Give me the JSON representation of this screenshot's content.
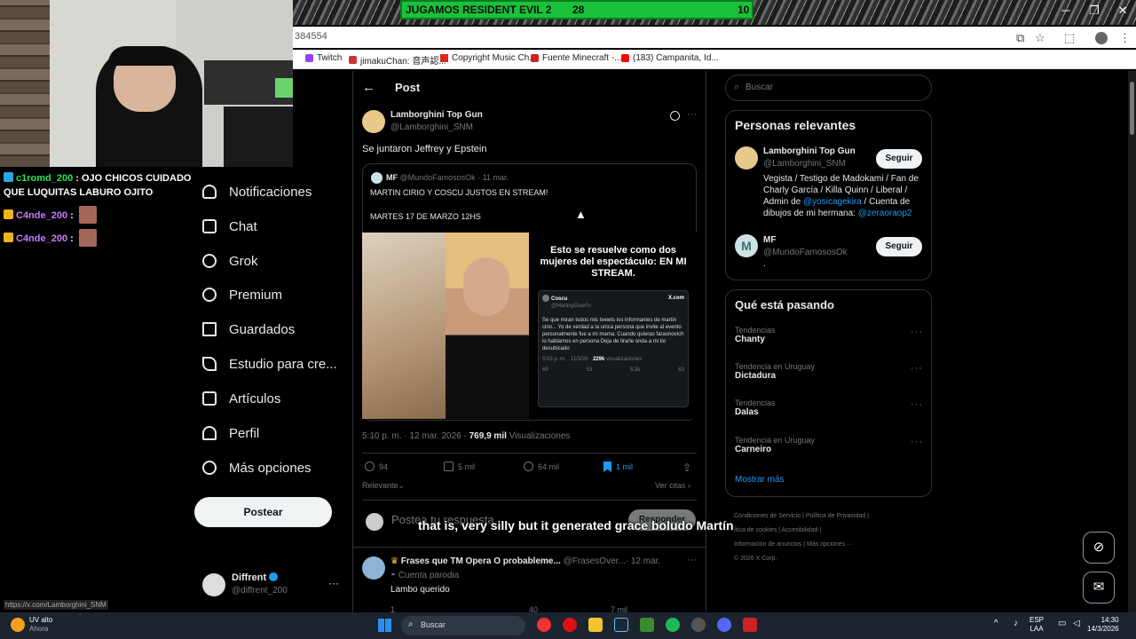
{
  "scoreboard": {
    "title": "JUGAMOS RESIDENT EVIL 2",
    "score_a": "28",
    "score_b": "10"
  },
  "browser": {
    "url": "384554",
    "bookmarks": [
      "Twitch",
      "jimakuChan: 音声認...",
      "Copyright Music Ch...",
      "Fuente Minecraft -...",
      "(183) Campanita, Id..."
    ],
    "controls": [
      "─",
      "❐",
      "✕"
    ]
  },
  "chat": [
    {
      "user": "c1romd_200",
      "message": " : OJO CHICOS CUIDADO QUE LUQUITAS LABURO OJITO"
    },
    {
      "user": "C4nde_200",
      "message": " :"
    },
    {
      "user": "C4nde_200",
      "message": " :"
    }
  ],
  "sidebar": {
    "items": [
      {
        "label": "Notificaciones",
        "icon": "bell-icon"
      },
      {
        "label": "Chat",
        "icon": "mail-icon"
      },
      {
        "label": "Grok",
        "icon": "grok-icon"
      },
      {
        "label": "Premium",
        "icon": "verified-icon"
      },
      {
        "label": "Guardados",
        "icon": "bookmark-icon"
      },
      {
        "label": "Estudio para cre...",
        "icon": "rocket-icon"
      },
      {
        "label": "Artículos",
        "icon": "article-icon"
      },
      {
        "label": "Perfil",
        "icon": "person-icon"
      },
      {
        "label": "Más opciones",
        "icon": "more-icon"
      }
    ],
    "post_button": "Postear",
    "account": {
      "name": "Diffrent",
      "handle": "@diffrent_200",
      "more": "···"
    }
  },
  "post": {
    "header_title": "Post",
    "author": "Lamborghini Top Gun",
    "handle": "@Lamborghini_SNM",
    "text": "Se juntaron Jeffrey y Epstein",
    "quote": {
      "author": "MF",
      "handle": "@MundoFamososOk",
      "date": "· 11 mar.",
      "line1": "MARTIN CIRIO Y COSCU JUSTOS EN STREAM!",
      "line2": "MARTES 17 DE MARZO 12HS",
      "image_caption": "Esto se resuelve como dos mujeres del espectáculo: EN MI STREAM.",
      "embedded_tweet": {
        "name": "Coscu",
        "handle": "@MartinpDiseño",
        "brand": "X.com",
        "body": "Se que miran todos mis tweets los informantes de martin cirio... Yo de verdad a la unica persona que invite al evento personalmente fue a mi mama. Cuando quieras faraonovich lo hablamos en persona Deja de tirarle onda a mi tio desubicado",
        "meta": "5:03 p. m. · 11/3/26 ·",
        "views": "229k",
        "views_label": " visualizaciones",
        "stats": [
          "69",
          "53",
          "5.3k",
          "83"
        ]
      }
    },
    "timestamp": "5:10 p. m. · 12 mar. 2026 · ",
    "views": "769,9 mil",
    "views_label": " Visualizaciones",
    "replies": "94",
    "reposts": "5 mil",
    "likes": "64 mil",
    "bookmarks": "1 mil",
    "sort": "Relevante",
    "see_quotes": "Ver citas",
    "reply_placeholder": "Postea tu respuesta",
    "reply_button": "Responder",
    "next": {
      "author": "Frases que TM Opera O probableme...",
      "handle": "@FrasesOver...",
      "date": "· 12 mar.",
      "label": "Cuenta parodia",
      "text": "Lambo querido",
      "stats": [
        "1",
        "",
        "40",
        "7 mil"
      ]
    }
  },
  "right": {
    "search_placeholder": "Buscar",
    "relevant_title": "Personas relevantes",
    "people": [
      {
        "name": "Lamborghini Top Gun",
        "handle": "@Lamborghini_SNM",
        "button": "Seguir",
        "bio_a": "Vegista / Testigo de Madokami / Fan de Charly García / Killa Quinn / Liberal / Admin de ",
        "bio_link1": "@yosicagekira",
        "bio_b": " / Cuenta de dibujos de mi hermana: ",
        "bio_link2": "@zeraoraop2"
      },
      {
        "name": "MF",
        "handle": "@MundoFamososOk",
        "button": "Seguir",
        "bio_a": "."
      }
    ],
    "trends_title": "Qué está pasando",
    "trends": [
      {
        "category": "Tendencias",
        "name": "Chanty"
      },
      {
        "category": "Tendencia en Uruguay",
        "name": "Dictadura"
      },
      {
        "category": "Tendencias",
        "name": "Dalas"
      },
      {
        "category": "Tendencia en Uruguay",
        "name": "Carneiro"
      }
    ],
    "show_more": "Mostrar más",
    "footer": [
      "Condiciones de Servicio",
      "|",
      "Política de Privacidad",
      "|",
      "ítica de cookies",
      "|",
      "Accesibilidad",
      "|",
      "Información de anuncios",
      "|",
      "Más opciones ···",
      "© 2026 X Corp."
    ]
  },
  "caption": "that is, very silly but it generated grace boludo Martín",
  "status_url": "https://x.com/Lamborghini_SNM",
  "taskbar": {
    "weather_title": "UV alto",
    "weather_sub": "Ahora",
    "search": "Buscar",
    "lang": "ESP",
    "lang2": "LAA",
    "time": "14:30",
    "date": "14/3/2026"
  },
  "colors": {
    "accent": "#1d9bf0",
    "scoreboard": "#19c23a",
    "twitch_user": "#27e34f",
    "twitch_user2": "#c87cff"
  }
}
